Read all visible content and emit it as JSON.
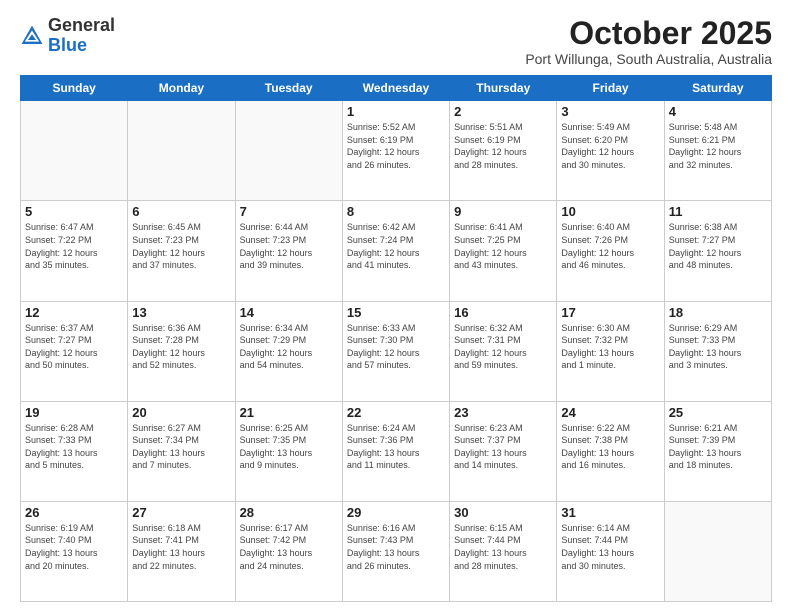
{
  "header": {
    "logo_general": "General",
    "logo_blue": "Blue",
    "month_title": "October 2025",
    "subtitle": "Port Willunga, South Australia, Australia"
  },
  "days_of_week": [
    "Sunday",
    "Monday",
    "Tuesday",
    "Wednesday",
    "Thursday",
    "Friday",
    "Saturday"
  ],
  "weeks": [
    [
      {
        "day": "",
        "info": ""
      },
      {
        "day": "",
        "info": ""
      },
      {
        "day": "",
        "info": ""
      },
      {
        "day": "1",
        "info": "Sunrise: 5:52 AM\nSunset: 6:19 PM\nDaylight: 12 hours\nand 26 minutes."
      },
      {
        "day": "2",
        "info": "Sunrise: 5:51 AM\nSunset: 6:19 PM\nDaylight: 12 hours\nand 28 minutes."
      },
      {
        "day": "3",
        "info": "Sunrise: 5:49 AM\nSunset: 6:20 PM\nDaylight: 12 hours\nand 30 minutes."
      },
      {
        "day": "4",
        "info": "Sunrise: 5:48 AM\nSunset: 6:21 PM\nDaylight: 12 hours\nand 32 minutes."
      }
    ],
    [
      {
        "day": "5",
        "info": "Sunrise: 6:47 AM\nSunset: 7:22 PM\nDaylight: 12 hours\nand 35 minutes."
      },
      {
        "day": "6",
        "info": "Sunrise: 6:45 AM\nSunset: 7:23 PM\nDaylight: 12 hours\nand 37 minutes."
      },
      {
        "day": "7",
        "info": "Sunrise: 6:44 AM\nSunset: 7:23 PM\nDaylight: 12 hours\nand 39 minutes."
      },
      {
        "day": "8",
        "info": "Sunrise: 6:42 AM\nSunset: 7:24 PM\nDaylight: 12 hours\nand 41 minutes."
      },
      {
        "day": "9",
        "info": "Sunrise: 6:41 AM\nSunset: 7:25 PM\nDaylight: 12 hours\nand 43 minutes."
      },
      {
        "day": "10",
        "info": "Sunrise: 6:40 AM\nSunset: 7:26 PM\nDaylight: 12 hours\nand 46 minutes."
      },
      {
        "day": "11",
        "info": "Sunrise: 6:38 AM\nSunset: 7:27 PM\nDaylight: 12 hours\nand 48 minutes."
      }
    ],
    [
      {
        "day": "12",
        "info": "Sunrise: 6:37 AM\nSunset: 7:27 PM\nDaylight: 12 hours\nand 50 minutes."
      },
      {
        "day": "13",
        "info": "Sunrise: 6:36 AM\nSunset: 7:28 PM\nDaylight: 12 hours\nand 52 minutes."
      },
      {
        "day": "14",
        "info": "Sunrise: 6:34 AM\nSunset: 7:29 PM\nDaylight: 12 hours\nand 54 minutes."
      },
      {
        "day": "15",
        "info": "Sunrise: 6:33 AM\nSunset: 7:30 PM\nDaylight: 12 hours\nand 57 minutes."
      },
      {
        "day": "16",
        "info": "Sunrise: 6:32 AM\nSunset: 7:31 PM\nDaylight: 12 hours\nand 59 minutes."
      },
      {
        "day": "17",
        "info": "Sunrise: 6:30 AM\nSunset: 7:32 PM\nDaylight: 13 hours\nand 1 minute."
      },
      {
        "day": "18",
        "info": "Sunrise: 6:29 AM\nSunset: 7:33 PM\nDaylight: 13 hours\nand 3 minutes."
      }
    ],
    [
      {
        "day": "19",
        "info": "Sunrise: 6:28 AM\nSunset: 7:33 PM\nDaylight: 13 hours\nand 5 minutes."
      },
      {
        "day": "20",
        "info": "Sunrise: 6:27 AM\nSunset: 7:34 PM\nDaylight: 13 hours\nand 7 minutes."
      },
      {
        "day": "21",
        "info": "Sunrise: 6:25 AM\nSunset: 7:35 PM\nDaylight: 13 hours\nand 9 minutes."
      },
      {
        "day": "22",
        "info": "Sunrise: 6:24 AM\nSunset: 7:36 PM\nDaylight: 13 hours\nand 11 minutes."
      },
      {
        "day": "23",
        "info": "Sunrise: 6:23 AM\nSunset: 7:37 PM\nDaylight: 13 hours\nand 14 minutes."
      },
      {
        "day": "24",
        "info": "Sunrise: 6:22 AM\nSunset: 7:38 PM\nDaylight: 13 hours\nand 16 minutes."
      },
      {
        "day": "25",
        "info": "Sunrise: 6:21 AM\nSunset: 7:39 PM\nDaylight: 13 hours\nand 18 minutes."
      }
    ],
    [
      {
        "day": "26",
        "info": "Sunrise: 6:19 AM\nSunset: 7:40 PM\nDaylight: 13 hours\nand 20 minutes."
      },
      {
        "day": "27",
        "info": "Sunrise: 6:18 AM\nSunset: 7:41 PM\nDaylight: 13 hours\nand 22 minutes."
      },
      {
        "day": "28",
        "info": "Sunrise: 6:17 AM\nSunset: 7:42 PM\nDaylight: 13 hours\nand 24 minutes."
      },
      {
        "day": "29",
        "info": "Sunrise: 6:16 AM\nSunset: 7:43 PM\nDaylight: 13 hours\nand 26 minutes."
      },
      {
        "day": "30",
        "info": "Sunrise: 6:15 AM\nSunset: 7:44 PM\nDaylight: 13 hours\nand 28 minutes."
      },
      {
        "day": "31",
        "info": "Sunrise: 6:14 AM\nSunset: 7:44 PM\nDaylight: 13 hours\nand 30 minutes."
      },
      {
        "day": "",
        "info": ""
      }
    ]
  ]
}
